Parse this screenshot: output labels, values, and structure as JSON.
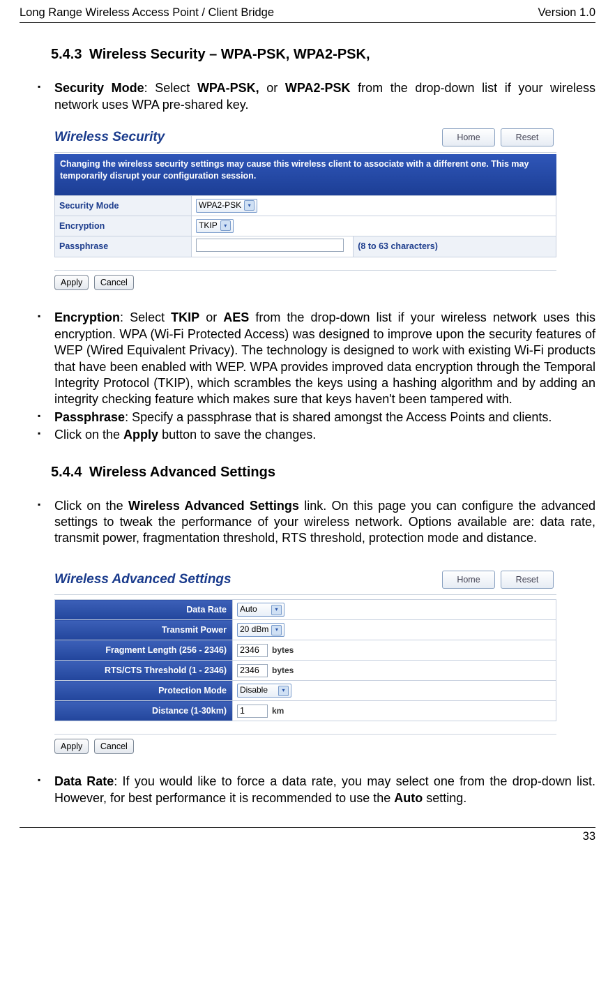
{
  "header": {
    "left": "Long Range Wireless Access Point / Client Bridge",
    "right": "Version 1.0"
  },
  "s1": {
    "num": "5.4.3",
    "title": "Wireless Security – WPA-PSK, WPA2-PSK,",
    "bullet1_pre": "Security Mode",
    "bullet1_mid": ": Select ",
    "bullet1_b1": "WPA-PSK,",
    "bullet1_mid2": " or ",
    "bullet1_b2": "WPA2-PSK",
    "bullet1_rest": " from the drop-down list if your wireless network uses WPA pre-shared key."
  },
  "shot1": {
    "title": "Wireless Security",
    "btn_home": "Home",
    "btn_reset": "Reset",
    "bluebar": "Changing the wireless security settings may cause this wireless client to associate with a different one. This may temporarily disrupt your configuration session.",
    "row1_label": "Security Mode",
    "row1_value": "WPA2-PSK",
    "row2_label": "Encryption",
    "row2_value": "TKIP",
    "row3_label": "Passphrase",
    "row3_help": "(8 to 63 characters)",
    "apply": "Apply",
    "cancel": "Cancel"
  },
  "s1b": {
    "enc_b": "Encryption",
    "enc_txt1": ": Select ",
    "enc_b2": "TKIP",
    "enc_txt2": " or ",
    "enc_b3": "AES",
    "enc_txt3": " from the drop-down list if your wireless network uses this encryption. WPA (Wi-Fi Protected Access) was designed to improve upon the security features of WEP (Wired Equivalent Privacy). The technology is designed to work with existing Wi-Fi products that have been enabled with WEP. WPA provides improved data encryption through the Temporal Integrity Protocol (TKIP), which scrambles the keys using a hashing algorithm and by adding an integrity checking feature which makes sure that keys haven't been tampered with.",
    "pass_b": "Passphrase",
    "pass_txt": ": Specify a passphrase that is shared amongst the Access Points and clients.",
    "apply_txt1": "Click on the ",
    "apply_b": "Apply",
    "apply_txt2": " button to save the changes."
  },
  "s2": {
    "num": "5.4.4",
    "title": "Wireless Advanced Settings",
    "bullet_txt1": "Click on the ",
    "bullet_b": "Wireless Advanced Settings",
    "bullet_txt2": " link. On this page you can configure the advanced settings to tweak the performance of your wireless network. Options available are: data rate, transmit power, fragmentation threshold, RTS threshold, protection mode and distance."
  },
  "shot2": {
    "title": "Wireless Advanced Settings",
    "btn_home": "Home",
    "btn_reset": "Reset",
    "rows": {
      "r1l": "Data Rate",
      "r1v": "Auto",
      "r2l": "Transmit Power",
      "r2v": "20 dBm",
      "r3l": "Fragment Length (256 - 2346)",
      "r3v": "2346",
      "r3u": "bytes",
      "r4l": "RTS/CTS Threshold (1 - 2346)",
      "r4v": "2346",
      "r4u": "bytes",
      "r5l": "Protection Mode",
      "r5v": "Disable",
      "r6l": "Distance (1-30km)",
      "r6v": "1",
      "r6u": "km"
    },
    "apply": "Apply",
    "cancel": "Cancel"
  },
  "s3": {
    "dr_b": "Data Rate",
    "dr_txt1": ": If you would like to force a data rate, you may select one from the drop-down list. However, for best performance it is recommended to use the ",
    "dr_b2": "Auto",
    "dr_txt2": " setting."
  },
  "footer": {
    "page": "33"
  }
}
